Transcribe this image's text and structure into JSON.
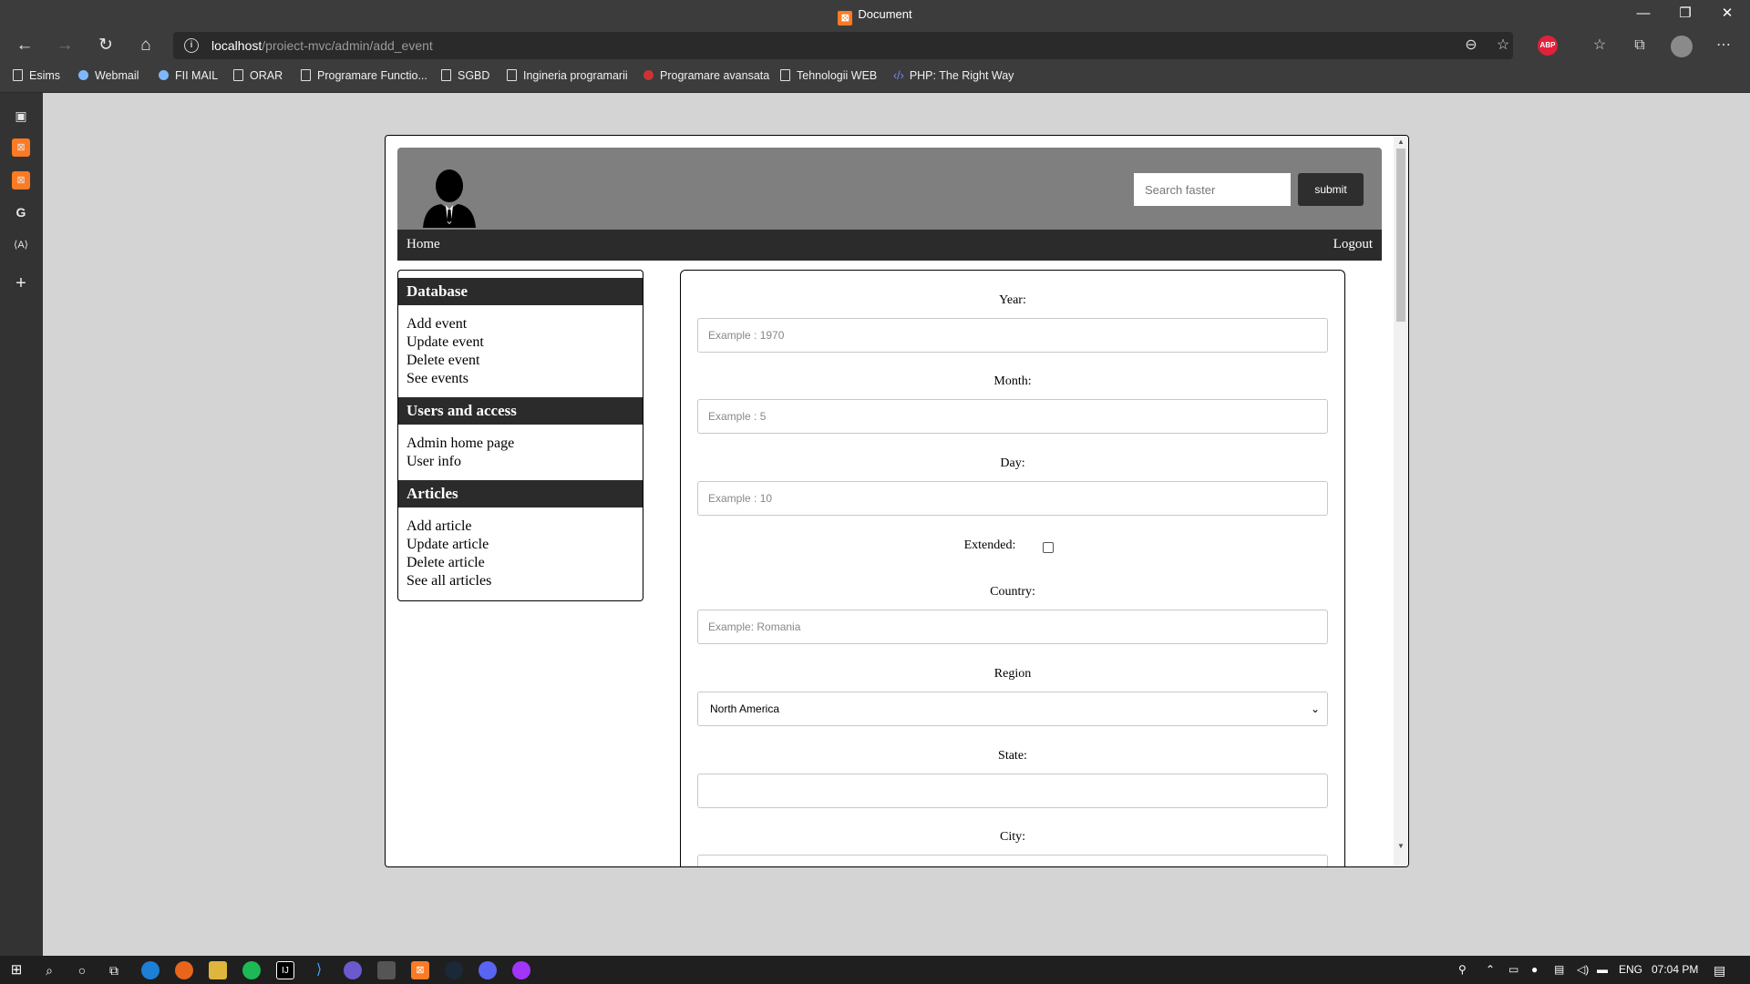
{
  "browser": {
    "window_title": "Document",
    "address": {
      "host": "localhost",
      "path": "/proiect-mvc/admin/add_event"
    },
    "ext_badge": "ABP",
    "bookmarks": [
      "Esims",
      "Webmail",
      "FII MAIL",
      "ORAR",
      "Programare Functio...",
      "SGBD",
      "Ingineria programarii",
      "Programare avansata",
      "Tehnologii WEB",
      "PHP: The Right Way"
    ]
  },
  "page": {
    "search_placeholder": "Search faster",
    "submit_label": "submit",
    "nav": {
      "home": "Home",
      "logout": "Logout"
    },
    "sidebar": {
      "sections": [
        {
          "title": "Database",
          "items": [
            "Add event",
            "Update event",
            "Delete event",
            "See events"
          ]
        },
        {
          "title": "Users and access",
          "items": [
            "Admin home page",
            "User info"
          ]
        },
        {
          "title": "Articles",
          "items": [
            "Add article",
            "Update article",
            "Delete article",
            "See all articles"
          ]
        }
      ]
    },
    "form": {
      "year_label": "Year:",
      "year_placeholder": "Example : 1970",
      "month_label": "Month:",
      "month_placeholder": "Example : 5",
      "day_label": "Day:",
      "day_placeholder": "Example : 10",
      "extended_label": "Extended:",
      "country_label": "Country:",
      "country_placeholder": "Example: Romania",
      "region_label": "Region",
      "region_value": "North America",
      "state_label": "State:",
      "city_label": "City:"
    }
  },
  "taskbar": {
    "lang": "ENG",
    "time": "07:04 PM"
  },
  "colors": {
    "header_bg": "#7f7f7f",
    "nav_bg": "#2b2b2b",
    "page_bg": "#d4d4d4"
  }
}
